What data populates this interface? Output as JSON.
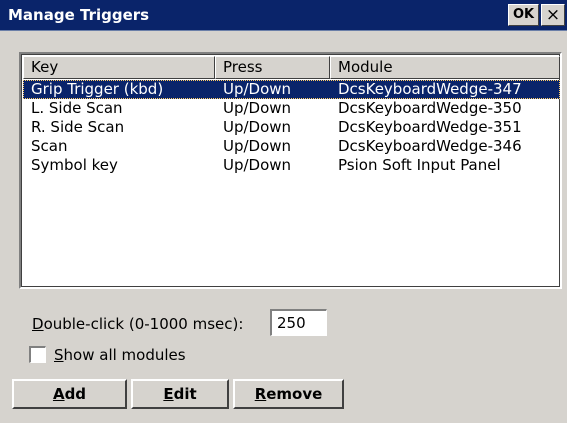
{
  "window": {
    "title": "Manage Triggers",
    "ok_label": "OK",
    "close_label": "×"
  },
  "list": {
    "columns": [
      "Key",
      "Press",
      "Module"
    ],
    "rows": [
      {
        "key": "Grip Trigger (kbd)",
        "press": "Up/Down",
        "module": "DcsKeyboardWedge-347",
        "selected": true
      },
      {
        "key": "L. Side Scan",
        "press": "Up/Down",
        "module": "DcsKeyboardWedge-350",
        "selected": false
      },
      {
        "key": "R. Side Scan",
        "press": "Up/Down",
        "module": "DcsKeyboardWedge-351",
        "selected": false
      },
      {
        "key": "Scan",
        "press": "Up/Down",
        "module": "DcsKeyboardWedge-346",
        "selected": false
      },
      {
        "key": "Symbol key",
        "press": "Up/Down",
        "module": "Psion Soft Input Panel",
        "selected": false
      }
    ]
  },
  "double_click": {
    "label_mnemonic": "D",
    "label_rest": "ouble-click (0-1000 msec):",
    "value": "250"
  },
  "show_all": {
    "label_mnemonic": "S",
    "label_rest": "how all modules",
    "checked": false
  },
  "buttons": {
    "add": {
      "mnemonic": "A",
      "rest": "dd"
    },
    "edit": {
      "mnemonic": "E",
      "rest": "dit"
    },
    "remove": {
      "mnemonic": "R",
      "rest": "emove"
    }
  },
  "colors": {
    "titlebar": "#0a246a",
    "selection": "#0a246a",
    "face": "#d6d3ce"
  }
}
